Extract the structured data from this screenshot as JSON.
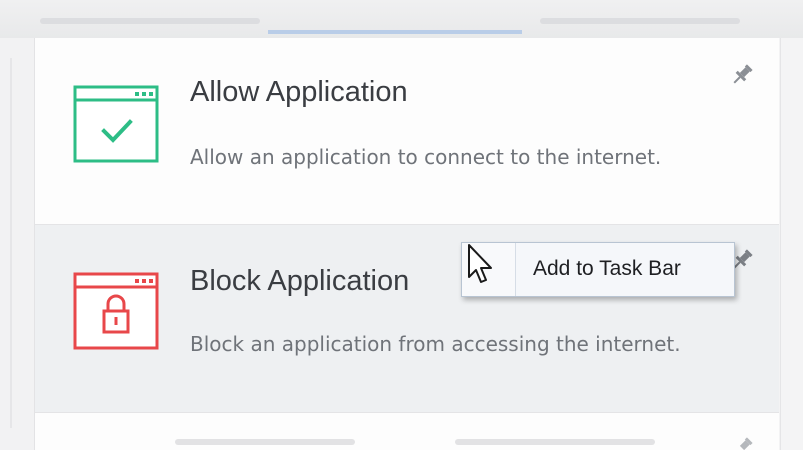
{
  "tasks": [
    {
      "title": "Allow Application",
      "description": "Allow an application to connect to the internet.",
      "icon": "window-check-icon",
      "color": "#2dbd86"
    },
    {
      "title": "Block Application",
      "description": "Block an application from accessing the internet.",
      "icon": "window-lock-icon",
      "color": "#e8474a"
    }
  ],
  "context_menu": {
    "item_label": "Add to Task Bar"
  },
  "colors": {
    "accent_tab": "#b9cde8",
    "title_text": "#3a3d42",
    "desc_text": "#6f7379"
  },
  "icons": {
    "pin": "pin-icon",
    "cursor": "mouse-cursor-icon"
  }
}
